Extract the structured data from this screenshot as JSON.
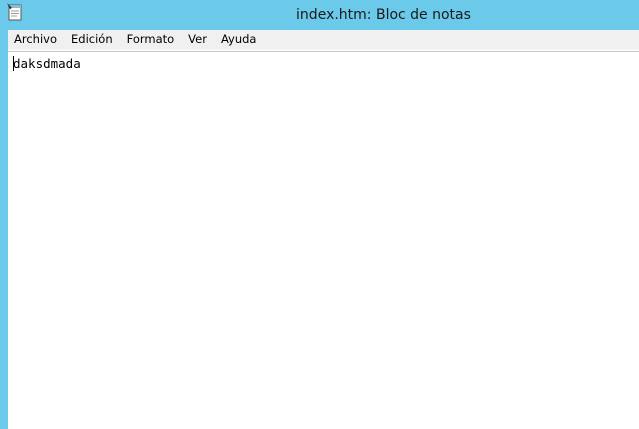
{
  "window": {
    "title": "index.htm: Bloc de notas",
    "titlebar_color": "#6bc9ea",
    "icon": "notepad-icon"
  },
  "menubar": {
    "items": [
      {
        "label": "Archivo"
      },
      {
        "label": "Edición"
      },
      {
        "label": "Formato"
      },
      {
        "label": "Ver"
      },
      {
        "label": "Ayuda"
      }
    ]
  },
  "editor": {
    "content": "daksdmada"
  }
}
